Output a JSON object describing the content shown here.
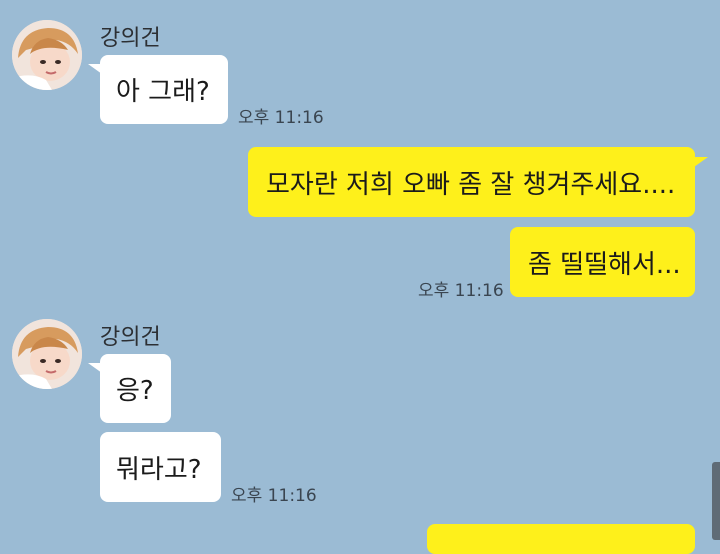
{
  "chat": {
    "groups": [
      {
        "sender": "강의건",
        "messages": [
          "아 그래?"
        ],
        "time": "오후 11:16"
      },
      {
        "outgoing": true,
        "messages": [
          "모자란 저희 오빠 좀 잘 챙겨주세요....",
          "좀 띨띨해서..."
        ],
        "time": "오후 11:16"
      },
      {
        "sender": "강의건",
        "messages": [
          "응?",
          "뭐라고?"
        ],
        "time": "오후 11:16"
      }
    ]
  },
  "colors": {
    "background": "#9bbbd4",
    "incoming_bubble": "#ffffff",
    "outgoing_bubble": "#fef01b"
  }
}
